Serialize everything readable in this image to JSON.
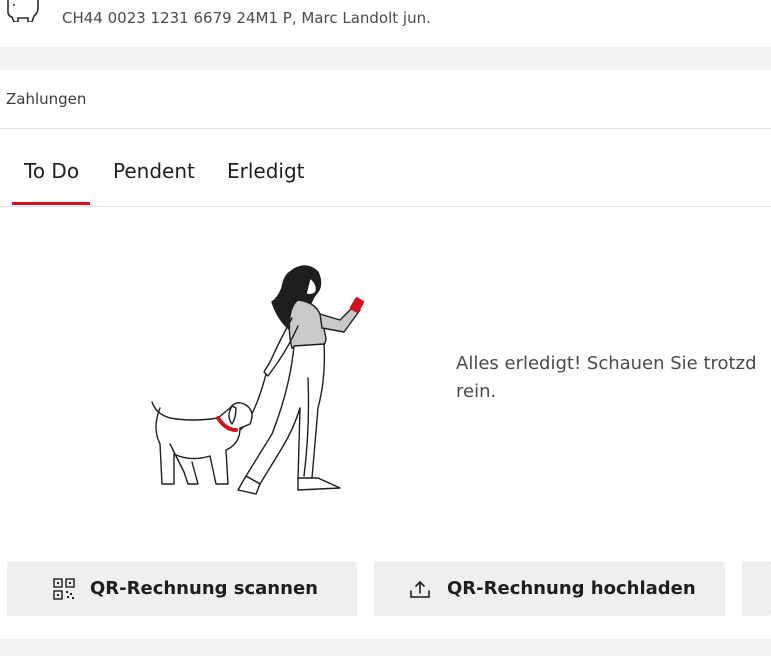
{
  "account": {
    "piggy_icon": "piggy-bank-icon",
    "iban_line": "CH44 0023 1231 6679 24M1 P, Marc Landolt jun."
  },
  "payments": {
    "title": "Zahlungen",
    "tabs": [
      {
        "label": "To Do",
        "active": true
      },
      {
        "label": "Pendent",
        "active": false
      },
      {
        "label": "Erledigt",
        "active": false
      }
    ],
    "empty_state": {
      "message": "Alles erledigt! Schauen Sie trotzd rein.",
      "illustration": "woman-walking-dog"
    },
    "actions": [
      {
        "label": "QR-Rechnung scannen",
        "icon": "qr-code-icon"
      },
      {
        "label": "QR-Rechnung hochladen",
        "icon": "upload-icon"
      }
    ]
  },
  "colors": {
    "accent": "#d3121c",
    "button_bg": "#efefef",
    "page_bg": "#f4f4f4"
  }
}
